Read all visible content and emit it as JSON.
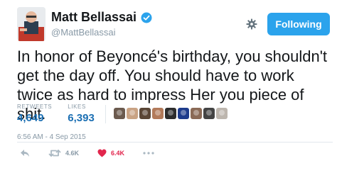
{
  "user": {
    "display_name": "Matt Bellassai",
    "handle": "@MattBellassai",
    "verified": true
  },
  "follow_button": {
    "label": "Following",
    "color": "#2ba3ec"
  },
  "tweet": {
    "text": "In honor of Beyoncé's birthday, you shouldn't get the day off. You should have to work twice as hard to impress Her you piece of shit.",
    "timestamp": "6:56 AM - 4 Sep 2015"
  },
  "stats": {
    "retweets_label": "RETWEETS",
    "retweets_value": "4,649",
    "likes_label": "LIKES",
    "likes_value": "6,393"
  },
  "likers": [
    {
      "color": "#6b5a4e"
    },
    {
      "color": "#c9a384"
    },
    {
      "color": "#5a4636"
    },
    {
      "color": "#b27a5a"
    },
    {
      "color": "#2d2d2d"
    },
    {
      "color": "#1e3c8c"
    },
    {
      "color": "#8a6a56"
    },
    {
      "color": "#444444"
    },
    {
      "color": "#bdb6ae"
    }
  ],
  "actions": {
    "retweet_count": "4.6K",
    "like_count": "6.4K"
  },
  "colors": {
    "accent": "#2ba3ec",
    "link_blue": "#1b6fb3",
    "like_red": "#e2264d",
    "muted": "#8899a6"
  }
}
